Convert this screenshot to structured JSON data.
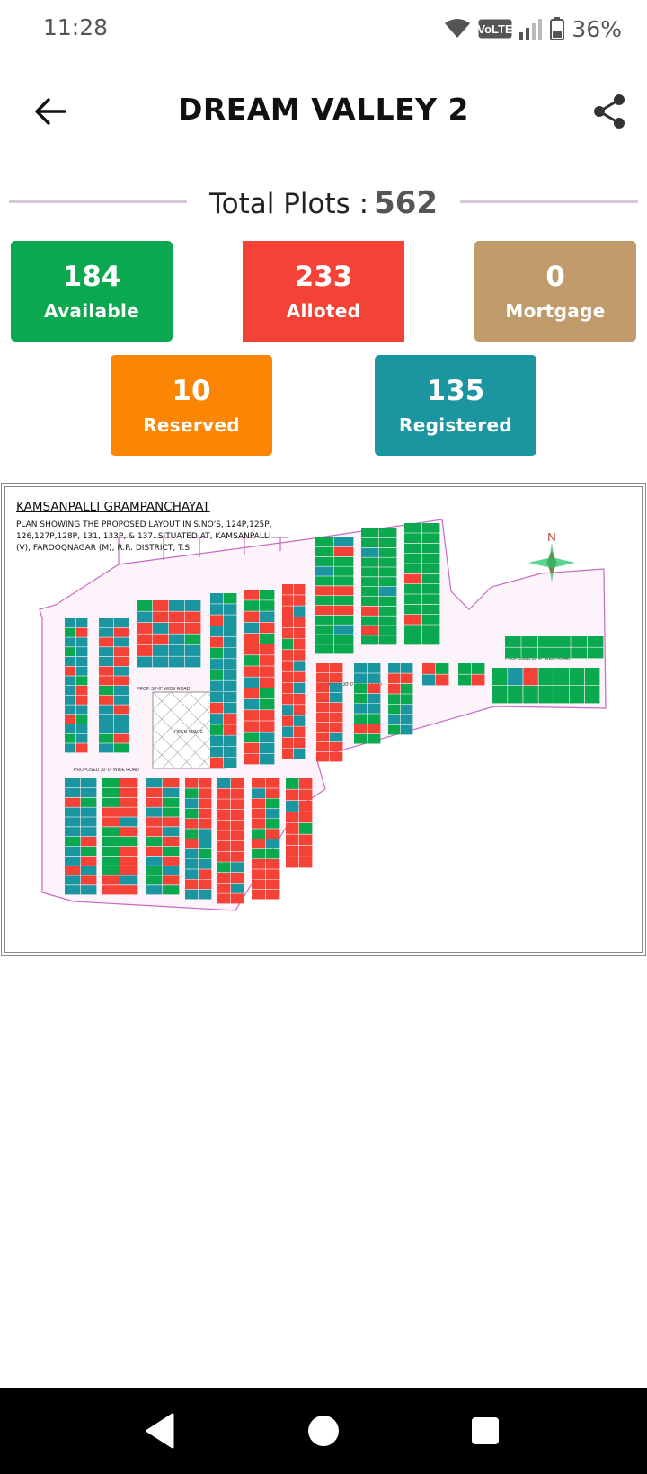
{
  "status_bar": {
    "time": "11:28",
    "battery": "36%",
    "icons": [
      "wifi-icon",
      "volte-icon",
      "signal-icon",
      "battery-icon"
    ],
    "volte_text": "VoLTE"
  },
  "header": {
    "title": "DREAM VALLEY 2",
    "back_icon": "arrow-left-icon",
    "share_icon": "share-icon"
  },
  "summary": {
    "total_label": "Total Plots :",
    "total_value": "562"
  },
  "stats": [
    {
      "value": "184",
      "label": "Available",
      "color": "#0aa84f"
    },
    {
      "value": "233",
      "label": "Alloted",
      "color": "#f44336"
    },
    {
      "value": "0",
      "label": "Mortgage",
      "color": "#c19a6b"
    },
    {
      "value": "10",
      "label": "Reserved",
      "color": "#fb8505"
    },
    {
      "value": "135",
      "label": "Registered",
      "color": "#1b96a0"
    }
  ],
  "layout_map": {
    "title": "KAMSANPALLI GRAMPANCHAYAT",
    "description": "PLAN SHOWING THE PROPOSED LAYOUT IN S.NO'S, 124P,125P, 126,127P,128P, 131, 133P, & 137. SITUATED AT, KAMSANPALLI (V), FAROOQNAGAR (M), R.R. DISTRICT, T.S.",
    "north_label": "N",
    "road_labels": [
      "PROPOSED 30'-0\" WIDE ROAD",
      "PROP. 30'-0\" WIDE ROAD",
      "PROPOSED 30'-0\" WIDE ROAD",
      "PROPOSED 33'-0\" WIDE ROAD"
    ],
    "park_label": "OPEN SPACE"
  },
  "nav": {
    "back_icon": "nav-back-icon",
    "home_icon": "nav-home-icon",
    "recents_icon": "nav-recents-icon"
  }
}
